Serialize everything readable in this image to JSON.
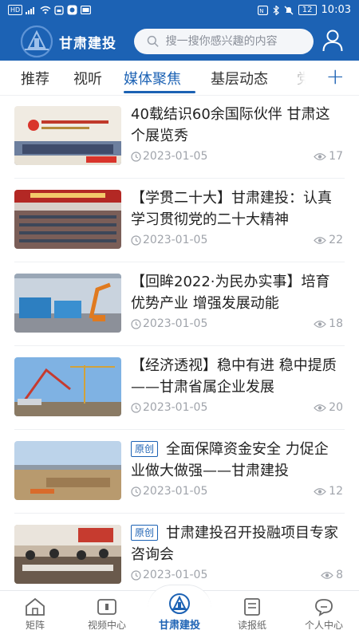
{
  "status_bar": {
    "left_icons": [
      "hd-icon",
      "signal-icon",
      "wifi-icon",
      "notification-icon",
      "app-icon",
      "image-icon"
    ],
    "hd_label": "HD",
    "battery": "12",
    "time": "10:03"
  },
  "header": {
    "brand": "甘肃建投",
    "search_placeholder": "搜一搜你感兴趣的内容"
  },
  "tabs": {
    "items": [
      "推荐",
      "视听",
      "媒体聚焦",
      "基层动态",
      "党"
    ],
    "active_index": 2,
    "accent": "#1c62b4"
  },
  "news": [
    {
      "badge": "",
      "title": "40载结识60余国际伙伴 甘肃这个展览秀",
      "date": "2023-01-05",
      "views": "17",
      "thumb_text": "40载结识60余国际伙伴 甘肃这个展览秀"
    },
    {
      "badge": "",
      "title": "【学贯二十大】甘肃建投：认真学习贯彻党的二十大精神",
      "date": "2023-01-05",
      "views": "22",
      "thumb_text": ""
    },
    {
      "badge": "",
      "title": "【回眸2022·为民办实事】培育优势产业 增强发展动能",
      "date": "2023-01-05",
      "views": "18",
      "thumb_text": ""
    },
    {
      "badge": "",
      "title": "【经济透视】稳中有进 稳中提质——甘肃省属企业发展",
      "date": "2023-01-05",
      "views": "20",
      "thumb_text": ""
    },
    {
      "badge": "原创",
      "title": "全面保障资金安全 力促企业做大做强——甘肃建投",
      "date": "2023-01-05",
      "views": "12",
      "thumb_text": ""
    },
    {
      "badge": "原创",
      "title": "甘肃建投召开投融项目专家咨询会",
      "date": "2023-01-05",
      "views": "8",
      "thumb_text": ""
    }
  ],
  "bottom_nav": {
    "items": [
      "矩阵",
      "视频中心",
      "甘肃建投",
      "读报纸",
      "个人中心"
    ],
    "active_index": 2
  }
}
